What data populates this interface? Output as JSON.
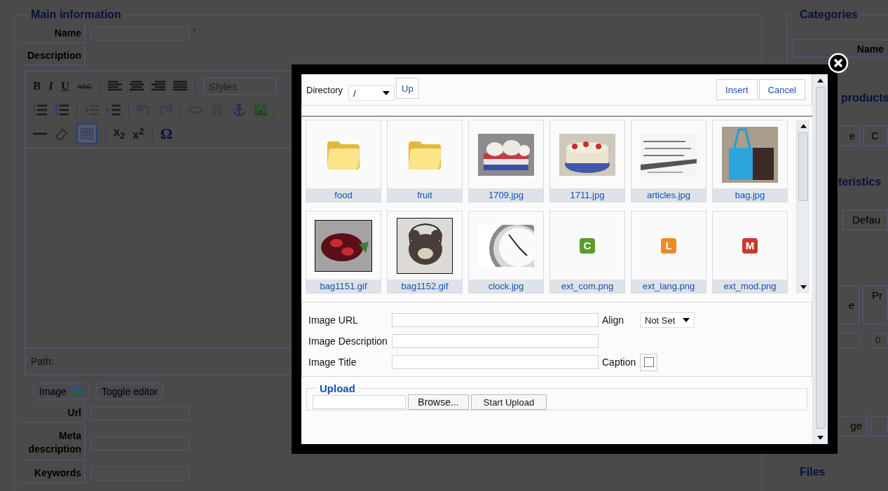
{
  "main_info": {
    "legend": "Main information",
    "name_label": "Name",
    "required_mark": "*",
    "description_label": "Description",
    "editor": {
      "format_buttons": [
        "B",
        "I",
        "U",
        "ABC"
      ],
      "styles": "Styles",
      "table_active": true,
      "script_buttons": [
        "x$_{2}$",
        "x$^{2}$"
      ],
      "symbol": "Ω",
      "path_label": "Path:"
    },
    "image_button": "Image",
    "toggle_button": "Toggle editor",
    "url_label": "Url",
    "meta_label": "Meta description",
    "keywords_label": "Keywords"
  },
  "right_column": {
    "categories_legend": "Categories",
    "categories_header": "Name",
    "products_legend": "products",
    "products_cells": [
      "e",
      "C"
    ],
    "characteristics_legend": "teristics",
    "characteristics_cell": "Defau",
    "table_headers": [
      "e",
      "Pr"
    ],
    "input_value": "0",
    "bottom_cell": "ge",
    "files_legend": "Files"
  },
  "dialog": {
    "directory_label": "Directory",
    "directory_value": "/",
    "up_button": "Up",
    "insert_button": "Insert",
    "cancel_button": "Cancel",
    "files": [
      {
        "name": "food",
        "kind": "folder"
      },
      {
        "name": "fruit",
        "kind": "folder"
      },
      {
        "name": "1709.jpg",
        "kind": "picture"
      },
      {
        "name": "1711.jpg",
        "kind": "picture"
      },
      {
        "name": "articles.jpg",
        "kind": "picture"
      },
      {
        "name": "bag.jpg",
        "kind": "picture"
      },
      {
        "name": "bag1151.gif",
        "kind": "picture"
      },
      {
        "name": "bag1152.gif",
        "kind": "picture"
      },
      {
        "name": "clock.jpg",
        "kind": "picture"
      },
      {
        "name": "ext_com.png",
        "kind": "badge",
        "letter": "C",
        "color": "#5a9e2a"
      },
      {
        "name": "ext_lang.png",
        "kind": "badge",
        "letter": "L",
        "color": "#f08a24"
      },
      {
        "name": "ext_mod.png",
        "kind": "badge",
        "letter": "M",
        "color": "#c63b2c"
      }
    ],
    "fields": [
      {
        "label": "Image URL"
      },
      {
        "label": "Image Description"
      },
      {
        "label": "Image Title"
      }
    ],
    "align_label": "Align",
    "align_value": "Not Set",
    "caption_label": "Caption",
    "caption_checked": false,
    "upload_legend": "Upload",
    "browse_button": "Browse...",
    "start_upload_button": "Start Upload"
  }
}
